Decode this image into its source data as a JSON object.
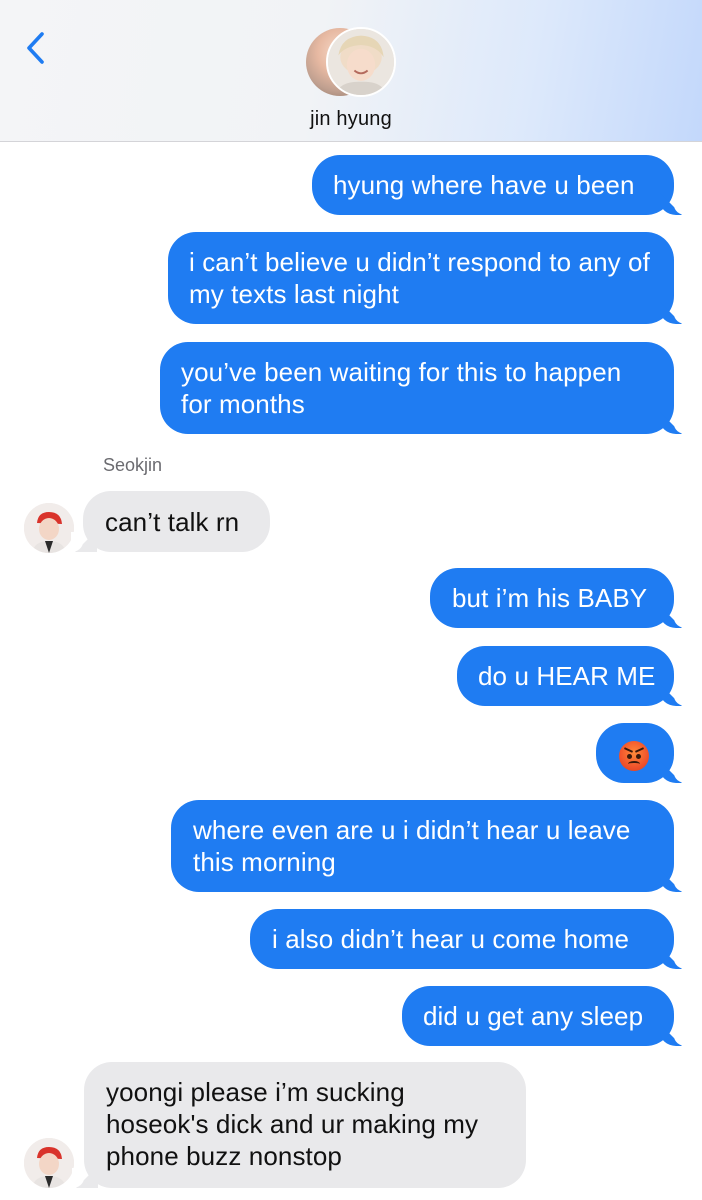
{
  "header": {
    "contact_name": "jin hyung",
    "back_icon": "chevron-left-icon",
    "accent": "#1f7cf2"
  },
  "thread": {
    "sender_name": "Seokjin",
    "messages": [
      {
        "direction": "outgoing",
        "text": "hyung where have u been"
      },
      {
        "direction": "outgoing",
        "text": "i can’t believe u didn’t respond to any of my texts last night"
      },
      {
        "direction": "outgoing",
        "text": "you’ve been waiting for this to happen for months"
      },
      {
        "direction": "incoming",
        "text": "can’t talk rn"
      },
      {
        "direction": "outgoing",
        "text": "but i’m his BABY"
      },
      {
        "direction": "outgoing",
        "text": "do u HEAR ME"
      },
      {
        "direction": "outgoing",
        "text": "",
        "emoji": "angry-face-emoji"
      },
      {
        "direction": "outgoing",
        "text": "where even are u i didn’t hear u leave this morning"
      },
      {
        "direction": "outgoing",
        "text": "i also didn’t hear u come home"
      },
      {
        "direction": "outgoing",
        "text": "did u get any sleep"
      },
      {
        "direction": "incoming",
        "text": "yoongi please i’m sucking hoseok's dick and ur making my phone buzz nonstop"
      }
    ]
  },
  "colors": {
    "outgoing_bubble": "#1f7cf2",
    "incoming_bubble": "#e9e9eb"
  }
}
